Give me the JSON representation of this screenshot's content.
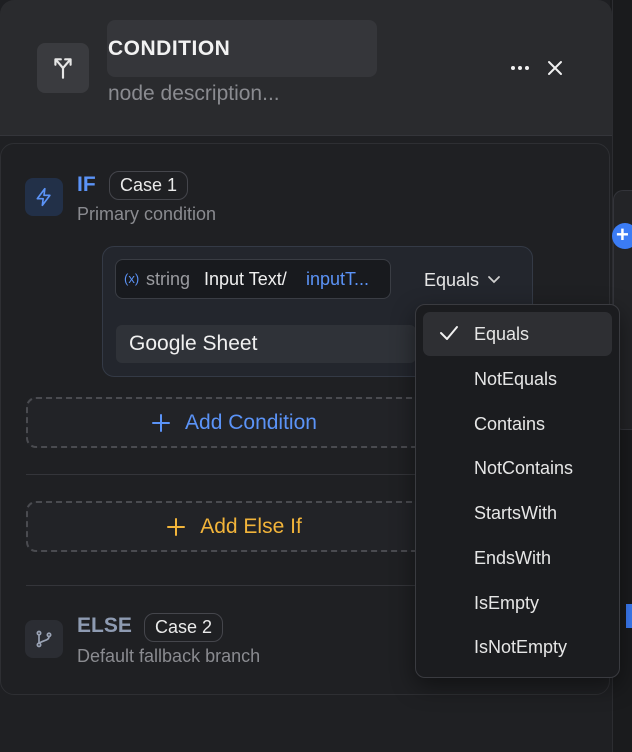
{
  "node": {
    "title": "CONDITION",
    "description_placeholder": "node description...",
    "icons": {
      "node": "split-branch-icon",
      "more": "more-horizontal-icon",
      "close": "close-icon"
    }
  },
  "if_block": {
    "label": "IF",
    "case": "Case 1",
    "subtitle": "Primary condition",
    "icon": "lightning-icon",
    "condition": {
      "variable_icon": "(x)",
      "variable_type": "string",
      "variable_name": "Input Text/",
      "variable_path": "inputT...",
      "operator": "Equals",
      "value": "Google Sheet"
    }
  },
  "add_condition_label": "Add Condition",
  "add_else_if_label": "Add Else If",
  "else_block": {
    "label": "ELSE",
    "case": "Case 2",
    "subtitle": "Default fallback branch",
    "icon": "git-branch-icon"
  },
  "operator_menu": {
    "selected": "Equals",
    "options": [
      "Equals",
      "NotEquals",
      "Contains",
      "NotContains",
      "StartsWith",
      "EndsWith",
      "IsEmpty",
      "IsNotEmpty"
    ]
  },
  "colors": {
    "accent_blue": "#5b93f7",
    "accent_yellow": "#f2b43a",
    "panel_bg": "#1f2023"
  }
}
